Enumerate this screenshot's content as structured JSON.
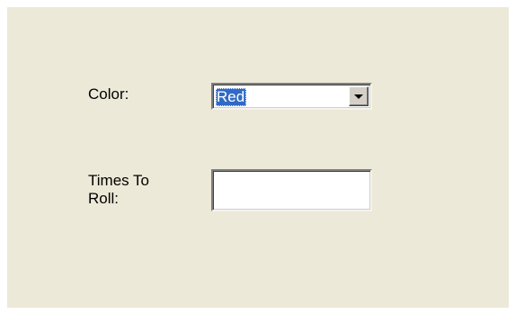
{
  "form": {
    "color_label": "Color:",
    "color_value": "Red",
    "times_label_line1": "Times To",
    "times_label_line2": "Roll:",
    "times_value": ""
  },
  "icons": {
    "dropdown": "chevron-down-icon"
  },
  "colors": {
    "panel_background": "#ece9d8",
    "selection_highlight": "#316ac5"
  }
}
